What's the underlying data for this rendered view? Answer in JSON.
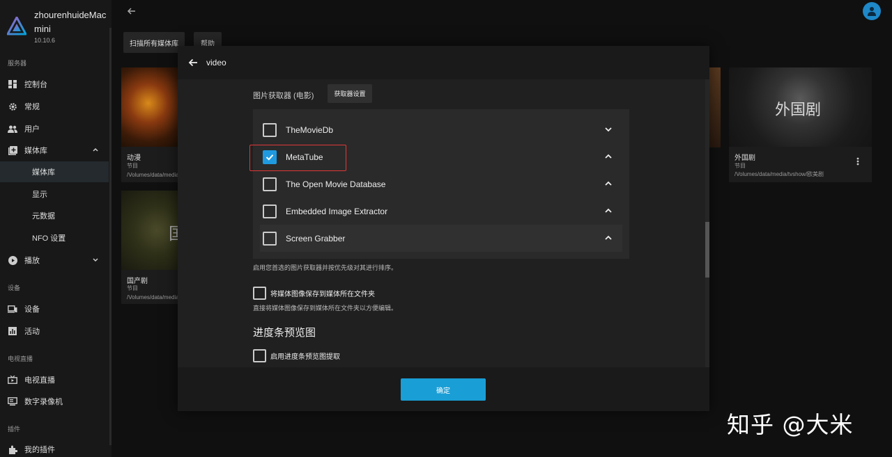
{
  "server": {
    "name": "zhourenhuideMac mini",
    "version": "10.10.6"
  },
  "sidebar": {
    "section_server": "服务器",
    "items_server": [
      {
        "label": "控制台",
        "icon": "dashboard-icon"
      },
      {
        "label": "常规",
        "icon": "gear-icon"
      },
      {
        "label": "用户",
        "icon": "users-icon"
      },
      {
        "label": "媒体库",
        "icon": "library-add-icon"
      }
    ],
    "library_sub": [
      "媒体库",
      "显示",
      "元数据",
      "NFO 设置"
    ],
    "playback": "播放",
    "section_devices": "设备",
    "items_devices": [
      {
        "label": "设备",
        "icon": "devices-icon"
      },
      {
        "label": "活动",
        "icon": "activity-icon"
      }
    ],
    "section_livetv": "电视直播",
    "items_livetv": [
      {
        "label": "电视直播",
        "icon": "live-tv-icon"
      },
      {
        "label": "数字录像机",
        "icon": "dvr-icon"
      }
    ],
    "section_plugins": "插件",
    "items_plugins": [
      {
        "label": "我的插件",
        "icon": "plugin-icon"
      }
    ]
  },
  "toolbar": {
    "scan_label": "扫描所有媒体库",
    "help_label": "帮助"
  },
  "cards": [
    {
      "title": "动漫",
      "type": "节目",
      "path": "/Volumes/data/media/tvshow/动漫"
    },
    {
      "title": "国产剧",
      "type": "节目",
      "path": "/Volumes/data/media/tvshow/国产剧"
    },
    {
      "title": "外国剧",
      "type": "节目",
      "path": "/Volumes/data/media/tvshow/欧美剧",
      "overlay": "外国剧"
    }
  ],
  "card_overlay_2": "国",
  "modal": {
    "title": "video",
    "fetcher_label": "图片获取器 (电影)",
    "fetcher_settings": "获取器设置",
    "fetchers": [
      {
        "label": "TheMovieDb",
        "checked": false,
        "chevron": "down"
      },
      {
        "label": "MetaTube",
        "checked": true,
        "chevron": "up"
      },
      {
        "label": "The Open Movie Database",
        "checked": false,
        "chevron": "up"
      },
      {
        "label": "Embedded Image Extractor",
        "checked": false,
        "chevron": "up"
      },
      {
        "label": "Screen Grabber",
        "checked": false,
        "chevron": "up"
      }
    ],
    "fetcher_hint": "启用您首选的图片获取器并按优先级对其进行排序。",
    "save_to_folder": "将媒体图像保存到媒体所在文件夹",
    "save_to_folder_hint": "直接将媒体图像保存到媒体所在文件夹以方便编辑。",
    "trickplay_heading": "进度条预览图",
    "trickplay_enable": "启用进度条预览图提取",
    "ok_label": "确定"
  },
  "watermark": "知乎 @大米",
  "colors": {
    "accent": "#1a9ed6",
    "highlight": "#e23838",
    "checked": "#1f9ae0"
  }
}
